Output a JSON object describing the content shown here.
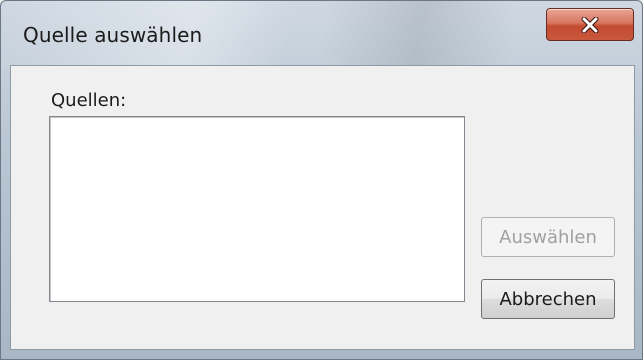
{
  "window": {
    "title": "Quelle auswählen"
  },
  "close_button": {
    "icon": "close-icon"
  },
  "sources": {
    "label": "Quellen:",
    "items": []
  },
  "buttons": {
    "select_label": "Auswählen",
    "select_enabled": false,
    "cancel_label": "Abbrechen"
  },
  "colors": {
    "close_button": "#c9593e",
    "disabled_text": "#a0a0a0"
  }
}
